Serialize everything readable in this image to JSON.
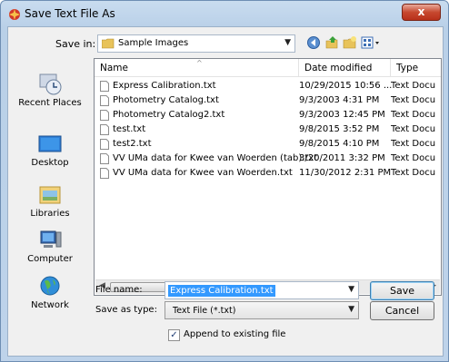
{
  "window": {
    "title": "Save Text File As",
    "close_label": "x"
  },
  "toolbar": {
    "save_in_label": "Save in:",
    "save_in_value": "Sample Images",
    "icons": [
      "back-icon",
      "up-folder-icon",
      "new-folder-icon",
      "view-menu-icon"
    ]
  },
  "places": [
    {
      "label": "Recent Places",
      "icon": "recent-places-icon"
    },
    {
      "label": "Desktop",
      "icon": "desktop-icon"
    },
    {
      "label": "Libraries",
      "icon": "libraries-icon"
    },
    {
      "label": "Computer",
      "icon": "computer-icon"
    },
    {
      "label": "Network",
      "icon": "network-icon"
    }
  ],
  "columns": {
    "name": "Name",
    "date": "Date modified",
    "type": "Type"
  },
  "files": [
    {
      "name": "Express Calibration.txt",
      "date": "10/29/2015 10:56 ...",
      "type": "Text Docu"
    },
    {
      "name": "Photometry Catalog.txt",
      "date": "9/3/2003 4:31 PM",
      "type": "Text Docu"
    },
    {
      "name": "Photometry Catalog2.txt",
      "date": "9/3/2003 12:45 PM",
      "type": "Text Docu"
    },
    {
      "name": "test.txt",
      "date": "9/8/2015 3:52 PM",
      "type": "Text Docu"
    },
    {
      "name": "test2.txt",
      "date": "9/8/2015 4:10 PM",
      "type": "Text Docu"
    },
    {
      "name": "VV UMa data for Kwee van Woerden (tab).txt",
      "date": "3/20/2011 3:32 PM",
      "type": "Text Docu"
    },
    {
      "name": "VV UMa data for Kwee van Woerden.txt",
      "date": "11/30/2012 2:31 PM",
      "type": "Text Docu"
    }
  ],
  "form": {
    "file_name_label": "File name:",
    "file_name_value": "Express Calibration.txt",
    "save_as_type_label": "Save as type:",
    "save_as_type_value": "Text File (*.txt)",
    "save_button": "Save",
    "cancel_button": "Cancel",
    "append_checkbox_label": "Append to existing file",
    "append_checked": true
  },
  "colors": {
    "selection": "#3399ff",
    "close_button": "#c7482f",
    "frame": "#b9d0e8"
  }
}
